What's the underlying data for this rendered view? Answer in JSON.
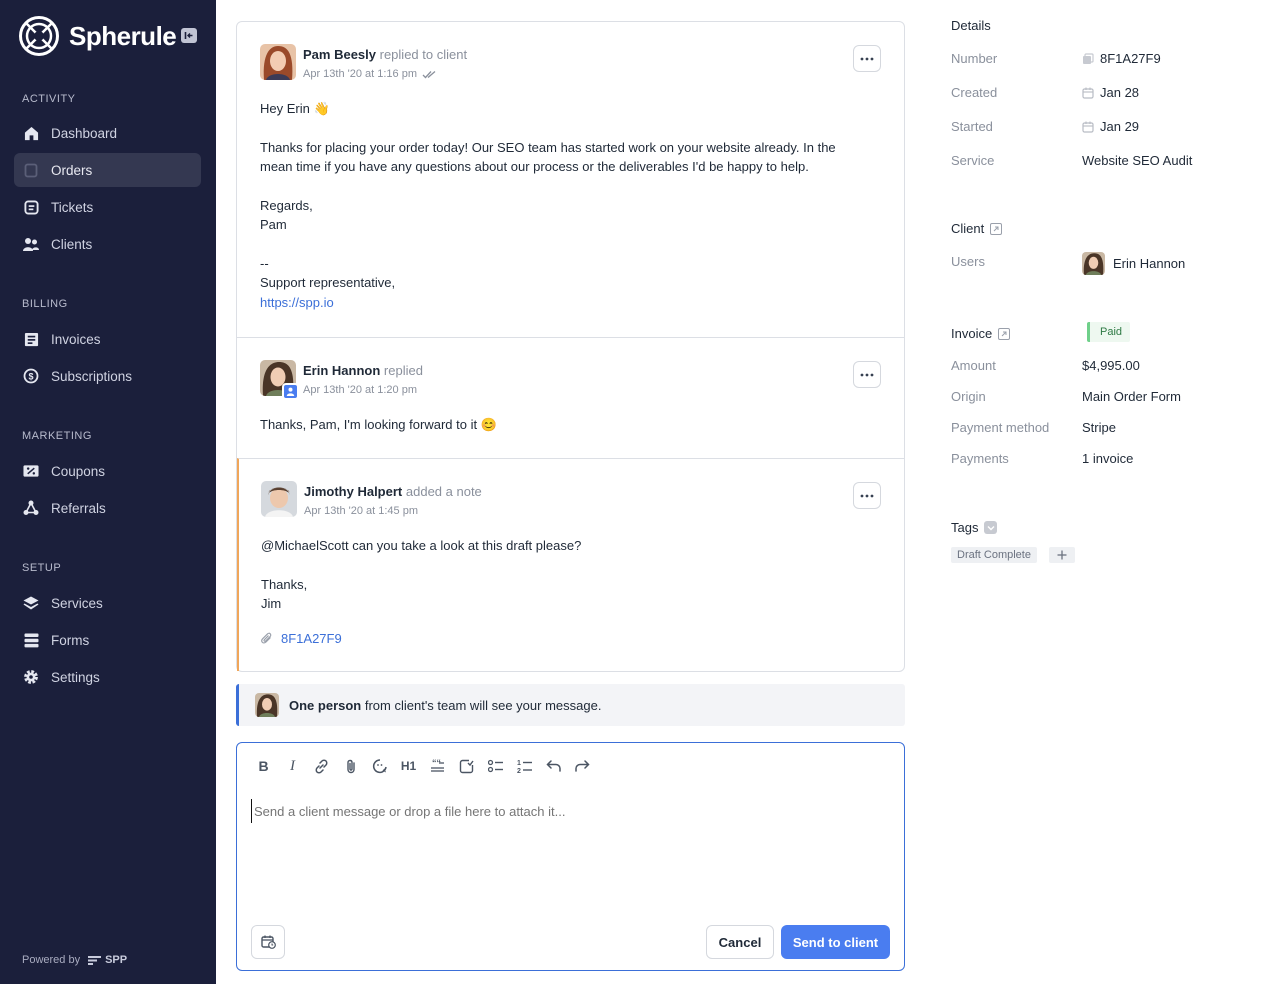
{
  "brand": {
    "name": "Spherule"
  },
  "sidebar": {
    "sections": [
      {
        "label": "ACTIVITY"
      },
      {
        "label": "BILLING"
      },
      {
        "label": "MARKETING"
      },
      {
        "label": "SETUP"
      }
    ],
    "items": [
      {
        "label": "Dashboard",
        "icon": "home-icon"
      },
      {
        "label": "Orders",
        "icon": "orders-icon",
        "active": true
      },
      {
        "label": "Tickets",
        "icon": "ticket-icon"
      },
      {
        "label": "Clients",
        "icon": "users-icon"
      },
      {
        "label": "Invoices",
        "icon": "invoice-icon"
      },
      {
        "label": "Subscriptions",
        "icon": "subscription-icon"
      },
      {
        "label": "Coupons",
        "icon": "coupon-icon"
      },
      {
        "label": "Referrals",
        "icon": "referral-icon"
      },
      {
        "label": "Services",
        "icon": "layers-icon"
      },
      {
        "label": "Forms",
        "icon": "forms-icon"
      },
      {
        "label": "Settings",
        "icon": "gear-icon"
      }
    ],
    "powered_by": "Powered by",
    "powered_brand": "SPP"
  },
  "messages": [
    {
      "author": "Pam Beesly",
      "action": "replied to client",
      "time": "Apr 13th '20 at 1:16 pm",
      "lines": [
        "Hey Erin 👋",
        "Thanks for placing your order today! Our SEO team has started work on your website already. In the",
        "mean time if you have any questions about our process or the deliverables I'd be happy to help.",
        "Regards,",
        "Pam",
        "--",
        "Support representative,"
      ],
      "link": "https://spp.io"
    },
    {
      "author": "Erin Hannon",
      "action": "replied",
      "time": "Apr 13th '20 at 1:20 pm",
      "lines": [
        "Thanks, Pam, I'm looking forward to it 😊"
      ]
    },
    {
      "author": "Jimothy Halpert",
      "action": "added a note",
      "time": "Apr 13th '20 at 1:45 pm",
      "lines": [
        "@MichaelScott can you take a look at this draft please?",
        "Thanks,",
        "Jim"
      ],
      "attachment": "8F1A27F9"
    }
  ],
  "notice": {
    "strong": "One person",
    "rest": " from client's team will see your message."
  },
  "composer": {
    "toolbar": [
      "B",
      "I",
      "link",
      "attach",
      "emoji",
      "H1",
      "quote",
      "code",
      "bullet-list",
      "numbered-list",
      "undo",
      "redo"
    ],
    "placeholder": "Send a client message or drop a file here to attach it...",
    "cancel_label": "Cancel",
    "send_label": "Send to client"
  },
  "details": {
    "title": "Details",
    "number_label": "Number",
    "number_value": "8F1A27F9",
    "created_label": "Created",
    "created_value": "Jan 28",
    "started_label": "Started",
    "started_value": "Jan 29",
    "service_label": "Service",
    "service_value": "Website SEO Audit",
    "client_title": "Client",
    "users_label": "Users",
    "users_value": "Erin Hannon",
    "invoice_title": "Invoice",
    "invoice_status": "Paid",
    "amount_label": "Amount",
    "amount_value": "$4,995.00",
    "origin_label": "Origin",
    "origin_value": "Main Order Form",
    "payment_method_label": "Payment method",
    "payment_method_value": "Stripe",
    "payments_label": "Payments",
    "payments_value": "1 invoice",
    "tags_title": "Tags",
    "tags": [
      "Draft Complete"
    ]
  },
  "colors": {
    "sidebar_bg": "#1b1f3b",
    "accent": "#4a7df0",
    "link": "#3b6fd8",
    "note_border": "#f0a65a",
    "paid": "#6fd08a"
  }
}
